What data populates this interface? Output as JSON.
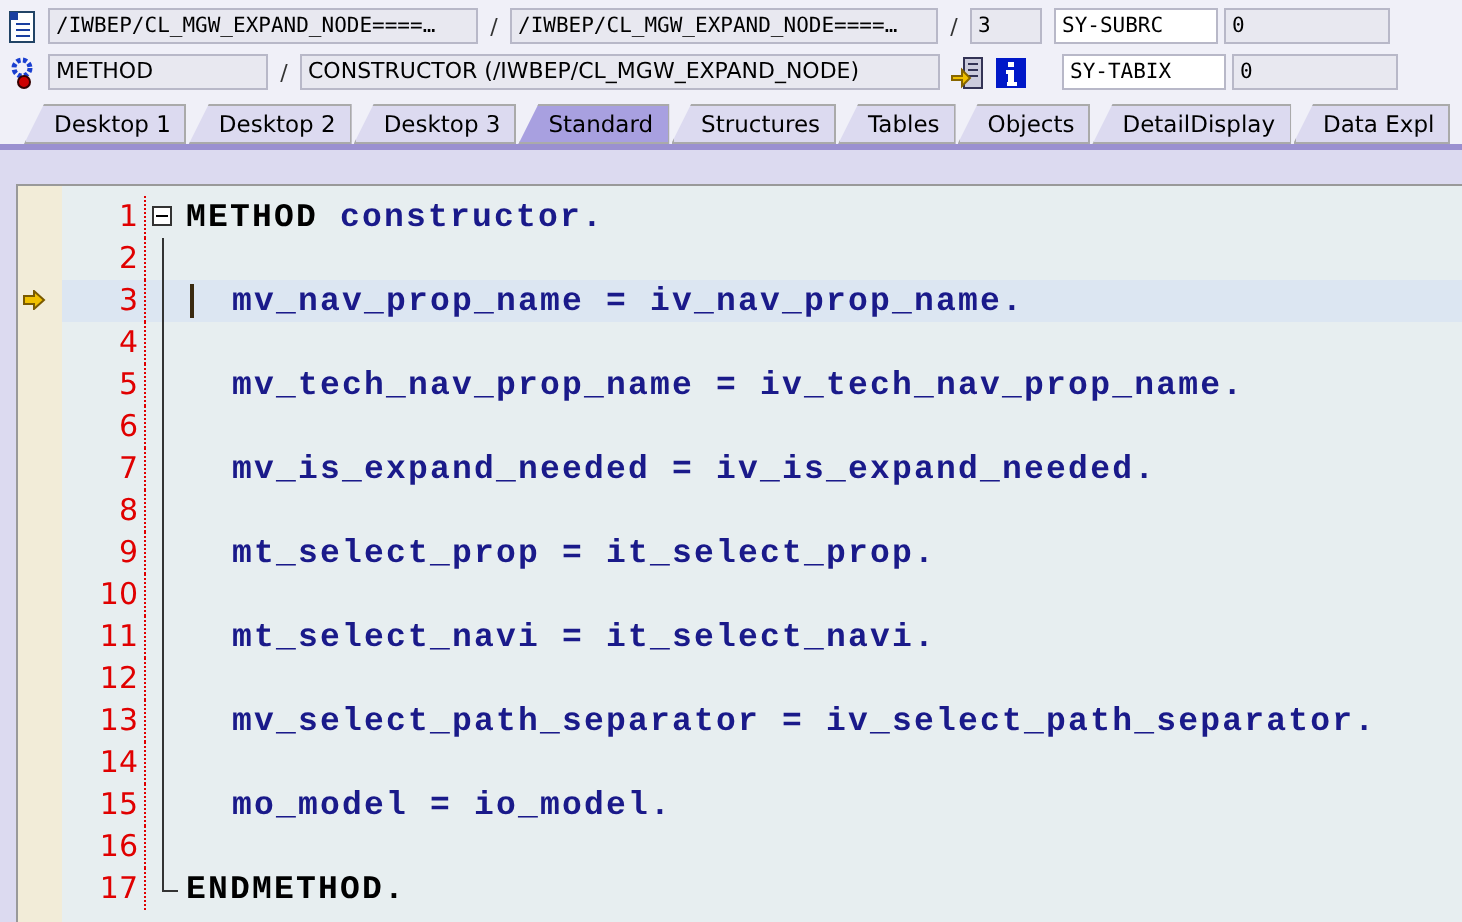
{
  "header": {
    "row1": {
      "include": "/IWBEP/CL_MGW_EXPAND_NODE====…",
      "separator_1": "/",
      "program": "/IWBEP/CL_MGW_EXPAND_NODE====…",
      "separator_2": "/",
      "line": "3",
      "var_name": "SY-SUBRC",
      "var_value": "0"
    },
    "row2": {
      "event_type": "METHOD",
      "separator": "/",
      "event": "CONSTRUCTOR (/IWBEP/CL_MGW_EXPAND_NODE)",
      "var_name": "SY-TABIX",
      "var_value": "0"
    }
  },
  "tabs": [
    {
      "label": "Desktop 1",
      "selected": false
    },
    {
      "label": "Desktop 2",
      "selected": false
    },
    {
      "label": "Desktop 3",
      "selected": false
    },
    {
      "label": "Standard",
      "selected": true
    },
    {
      "label": "Structures",
      "selected": false
    },
    {
      "label": "Tables",
      "selected": false
    },
    {
      "label": "Objects",
      "selected": false
    },
    {
      "label": "DetailDisplay",
      "selected": false
    },
    {
      "label": "Data Expl",
      "selected": false
    }
  ],
  "code": [
    {
      "number": "1",
      "kind": "block_start",
      "current": false,
      "parts": [
        {
          "text": "METHOD",
          "kind": "keyword"
        },
        {
          "text": "constructor.",
          "kind": "name"
        }
      ]
    },
    {
      "number": "2",
      "kind": "blank",
      "current": false
    },
    {
      "number": "3",
      "kind": "statement",
      "current": true,
      "parts": [
        {
          "text": "mv_nav_prop_name = iv_nav_prop_name.",
          "kind": "name"
        }
      ]
    },
    {
      "number": "4",
      "kind": "blank",
      "current": false
    },
    {
      "number": "5",
      "kind": "statement",
      "current": false,
      "parts": [
        {
          "text": "mv_tech_nav_prop_name = iv_tech_nav_prop_name.",
          "kind": "name"
        }
      ]
    },
    {
      "number": "6",
      "kind": "blank",
      "current": false
    },
    {
      "number": "7",
      "kind": "statement",
      "current": false,
      "parts": [
        {
          "text": "mv_is_expand_needed = iv_is_expand_needed.",
          "kind": "name"
        }
      ]
    },
    {
      "number": "8",
      "kind": "blank",
      "current": false
    },
    {
      "number": "9",
      "kind": "statement",
      "current": false,
      "parts": [
        {
          "text": "mt_select_prop = it_select_prop.",
          "kind": "name"
        }
      ]
    },
    {
      "number": "10",
      "kind": "blank",
      "current": false
    },
    {
      "number": "11",
      "kind": "statement",
      "current": false,
      "parts": [
        {
          "text": "mt_select_navi = it_select_navi.",
          "kind": "name"
        }
      ]
    },
    {
      "number": "12",
      "kind": "blank",
      "current": false
    },
    {
      "number": "13",
      "kind": "statement",
      "current": false,
      "parts": [
        {
          "text": "mv_select_path_separator = iv_select_path_separator.",
          "kind": "name"
        }
      ]
    },
    {
      "number": "14",
      "kind": "blank",
      "current": false
    },
    {
      "number": "15",
      "kind": "statement",
      "current": false,
      "parts": [
        {
          "text": "mo_model = io_model.",
          "kind": "name"
        }
      ]
    },
    {
      "number": "16",
      "kind": "blank",
      "current": false
    },
    {
      "number": "17",
      "kind": "block_end",
      "current": false,
      "parts": [
        {
          "text": "ENDMETHOD.",
          "kind": "keyword"
        }
      ]
    }
  ]
}
